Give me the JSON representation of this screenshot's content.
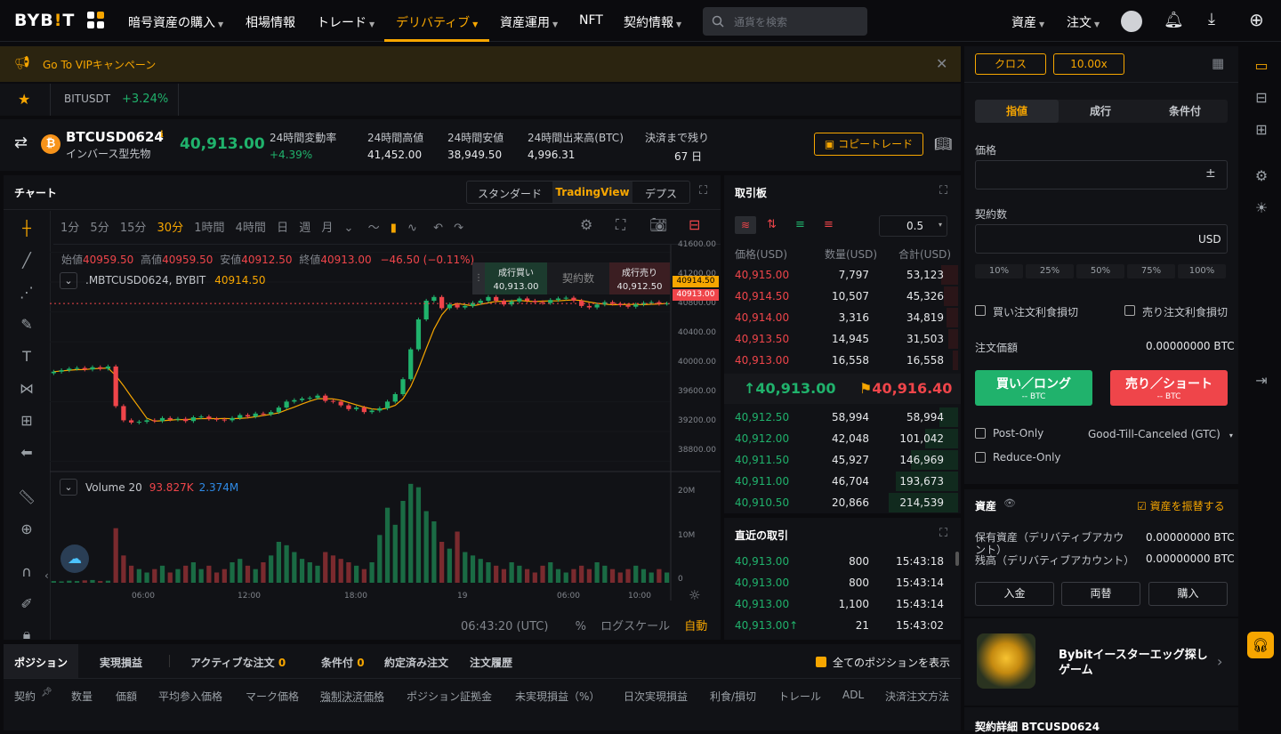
{
  "nav": {
    "logo_a": "BYB",
    "logo_b": "!",
    "logo_c": "T",
    "items": [
      "暗号資産の購入",
      "相場情報",
      "トレード",
      "デリバティブ",
      "資産運用",
      "NFT",
      "契約情報"
    ],
    "search_placeholder": "通貨を検索",
    "assets": "資産",
    "orders": "注文"
  },
  "banner": {
    "text": "Go To VIPキャンペーン"
  },
  "fav": {
    "symbol": "BITUSDT",
    "change": "+3.24%"
  },
  "ticker": {
    "symbol": "BTCUSD0624",
    "type": "インバース型先物",
    "price": "40,913.00",
    "stats": [
      {
        "label": "24時間変動率",
        "value": "+4.39%"
      },
      {
        "label": "24時間高値",
        "value": "41,452.00"
      },
      {
        "label": "24時間安値",
        "value": "38,949.50"
      },
      {
        "label": "24時間出来高(BTC)",
        "value": "4,996.31"
      },
      {
        "label": "決済まで残り",
        "value": "67 日"
      }
    ],
    "copy_trade": "コピートレード"
  },
  "chart": {
    "title": "チャート",
    "views": [
      "スタンダード",
      "TradingView",
      "デプス"
    ],
    "intervals": [
      "1分",
      "5分",
      "15分",
      "30分",
      "1時間",
      "4時間",
      "日",
      "週",
      "月"
    ],
    "ohlc": {
      "o_label": "始値",
      "o": "40959.50",
      "h_label": "高値",
      "h": "40959.50",
      "l_label": "安値",
      "l": "40912.50",
      "c_label": "終値",
      "c": "40913.00",
      "chg": "−46.50 (−0.11%)"
    },
    "symbol_line": ".MBTCUSD0624, BYBIT",
    "symbol_price": "40914.50",
    "buy_label": "成行買い",
    "buy_price": "40,913.00",
    "qty_label": "契約数",
    "sell_label": "成行売り",
    "sell_price": "40,912.50",
    "price_ticks": [
      "41600.00",
      "41200.00",
      "40800.00",
      "40400.00",
      "40000.00",
      "39600.00",
      "39200.00",
      "38800.00"
    ],
    "tag_a": "40914.50",
    "tag_b": "40913.00",
    "volume_label": "Volume 20",
    "vol_a": "93.827K",
    "vol_b": "2.374M",
    "vol_ticks": [
      "20M",
      "10M",
      "0"
    ],
    "time_ticks": [
      "06:00",
      "12:00",
      "18:00",
      "19",
      "06:00",
      "10:00"
    ],
    "footer_time": "06:43:20 (UTC)",
    "footer_pct": "%",
    "footer_log": "ログスケール",
    "footer_auto": "自動"
  },
  "chart_data": {
    "type": "candlestick",
    "x": [
      "06:00",
      "12:00",
      "18:00",
      "19",
      "06:00",
      "10:00"
    ],
    "ylim": [
      38700,
      41700
    ],
    "close": [
      40000,
      40020,
      40040,
      40050,
      40030,
      40060,
      40040,
      40070,
      39540,
      39350,
      39320,
      39330,
      39350,
      39340,
      39380,
      39360,
      39370,
      39340,
      39390,
      39400,
      39370,
      39360,
      39350,
      39380,
      39420,
      39400,
      39440,
      39430,
      39460,
      39520,
      39600,
      39620,
      39640,
      39650,
      39680,
      39610,
      39600,
      39550,
      39500,
      39520,
      39460,
      39480,
      39510,
      39600,
      39700,
      39900,
      40300,
      40700,
      40950,
      41000,
      40850,
      40900,
      40860,
      40880,
      40920,
      40950,
      41000,
      40950,
      40900,
      40940,
      40980,
      40950,
      40930,
      40920,
      40960,
      40980,
      40990,
      40950,
      40880,
      40860,
      40900,
      40930,
      40910,
      40890,
      40870,
      40900,
      40920,
      40930,
      40910,
      40913
    ],
    "volume": [
      0.5,
      0.4,
      0.6,
      0.5,
      0.7,
      0.8,
      0.5,
      0.6,
      16,
      8,
      5,
      4,
      3,
      4,
      5,
      3,
      4,
      5,
      6,
      4,
      5,
      3,
      4,
      6,
      7,
      5,
      4,
      6,
      8,
      12,
      11,
      9,
      7,
      6,
      5,
      9,
      8,
      7,
      6,
      5,
      4,
      6,
      14,
      22,
      17,
      24,
      29,
      28,
      21,
      18,
      12,
      10,
      15,
      9,
      8,
      7,
      6,
      5,
      4,
      6,
      5,
      4,
      3,
      5,
      6,
      4,
      3,
      4,
      5,
      4,
      6,
      5,
      4,
      3,
      4,
      5,
      4,
      3,
      4,
      3
    ]
  },
  "orderbook": {
    "title": "取引板",
    "step": "0.5",
    "cols": [
      "価格(USD)",
      "数量(USD)",
      "合計(USD)"
    ],
    "asks": [
      [
        "40,915.00",
        "7,797",
        "53,123"
      ],
      [
        "40,914.50",
        "10,507",
        "45,326"
      ],
      [
        "40,914.00",
        "3,316",
        "34,819"
      ],
      [
        "40,913.50",
        "14,945",
        "31,503"
      ],
      [
        "40,913.00",
        "16,558",
        "16,558"
      ]
    ],
    "last": "40,913.00",
    "mark": "40,916.40",
    "bids": [
      [
        "40,912.50",
        "58,994",
        "58,994"
      ],
      [
        "40,912.00",
        "42,048",
        "101,042"
      ],
      [
        "40,911.50",
        "45,927",
        "146,969"
      ],
      [
        "40,911.00",
        "46,704",
        "193,673"
      ],
      [
        "40,910.50",
        "20,866",
        "214,539"
      ]
    ]
  },
  "trades": {
    "title": "直近の取引",
    "rows": [
      [
        "40,913.00",
        "800",
        "15:43:18"
      ],
      [
        "40,913.00",
        "800",
        "15:43:14"
      ],
      [
        "40,913.00",
        "1,100",
        "15:43:14"
      ],
      [
        "40,913.00↑",
        "21",
        "15:43:02"
      ]
    ]
  },
  "positions": {
    "tabs": [
      "ポジション",
      "実現損益",
      "アクティブな注文",
      "条件付",
      "約定済み注文",
      "注文履歴"
    ],
    "active_count": "0",
    "cond_count": "0",
    "show_all": "全てのポジションを表示",
    "cols": [
      "契約",
      "数量",
      "価額",
      "平均参入価格",
      "マーク価格",
      "強制決済価格",
      "ポジション証拠金",
      "未実現損益（%）",
      "日次実現損益",
      "利食/損切",
      "トレール",
      "ADL",
      "決済注文方法"
    ]
  },
  "order": {
    "margin_mode": "クロス",
    "leverage": "10.00x",
    "types": [
      "指値",
      "成行",
      "条件付"
    ],
    "price_label": "価格",
    "qty_label": "契約数",
    "qty_unit": "USD",
    "pcts": [
      "10%",
      "25%",
      "50%",
      "75%",
      "100%"
    ],
    "tp_buy": "買い注文利食損切",
    "tp_sell": "売り注文利食損切",
    "value_label": "注文価額",
    "value": "0.00000000 BTC",
    "buy": "買い／ロング",
    "buy_sub": "-- BTC",
    "sell": "売り／ショート",
    "sell_sub": "-- BTC",
    "post_only": "Post-Only",
    "tif": "Good-Till-Canceled (GTC)",
    "reduce_only": "Reduce-Only"
  },
  "assets": {
    "title": "資産",
    "transfer": "資産を振替する",
    "held_label": "保有資産（デリバティブアカウント）",
    "held": "0.00000000 BTC",
    "bal_label": "残高（デリバティブアカウント）",
    "bal": "0.00000000 BTC",
    "buttons": [
      "入金",
      "両替",
      "購入"
    ]
  },
  "promo": {
    "text": "Bybitイースターエッグ探しゲーム"
  },
  "contract": {
    "title": "契約詳細 BTCUSD0624"
  },
  "colors": {
    "green": "#20b26c",
    "red": "#ef454a",
    "accent": "#f7a600"
  }
}
